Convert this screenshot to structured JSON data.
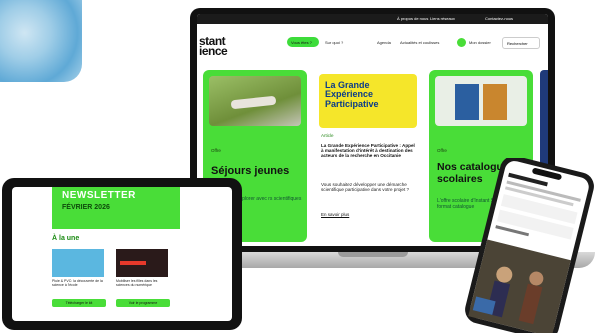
{
  "colors": {
    "brand_green": "#49dd38",
    "yellow": "#f5e62a",
    "dark": "#111111"
  },
  "laptop": {
    "topbar": {
      "about": "À propos de nous",
      "links": "Liens réseaux",
      "contact": "Contactez-nous"
    },
    "logo_line1": "stant",
    "logo_line2": "ience",
    "nav": {
      "vous_etes": "Vous êtes ?",
      "sur_quoi": "Sur quoi ?",
      "agenda": "Agenda",
      "actualites": "Actualités et coulisses",
      "mon_dossier": "Mon dossier",
      "rechercher": "Rechercher"
    },
    "cards": [
      {
        "tag": "Offre",
        "title": "Séjours jeunes 2026",
        "desc": "n univers à explorer avec rs scientifiques"
      },
      {
        "banner": "La Grande Expérience Participative",
        "tag": "Article",
        "title": "La Grande Expérience Participative : Appel à manifestation d'intérêt à destination des acteurs de la recherche en Occitanie",
        "desc": "Vous souhaitez développer une démarche scientifique participative dans votre projet ?",
        "link": "En savoir plus"
      },
      {
        "tag": "Offre",
        "title": "Nos catalogues scolaires",
        "desc": "L'offre scolaire d'Instant Science au format catalogue"
      }
    ]
  },
  "tablet": {
    "newsletter": "NEWSLETTER",
    "month": "FÉVRIER 2026",
    "section": "À la une",
    "item1_text": "Pluie & PVC: la découverte de la science à l'école",
    "item1_button": "Télécharger le kit",
    "item2_text": "Mobiliser les filles dans les sciences du numérique",
    "item2_button": "Voir le programme"
  },
  "phone": {
    "screen": "Instant Science mobile"
  }
}
